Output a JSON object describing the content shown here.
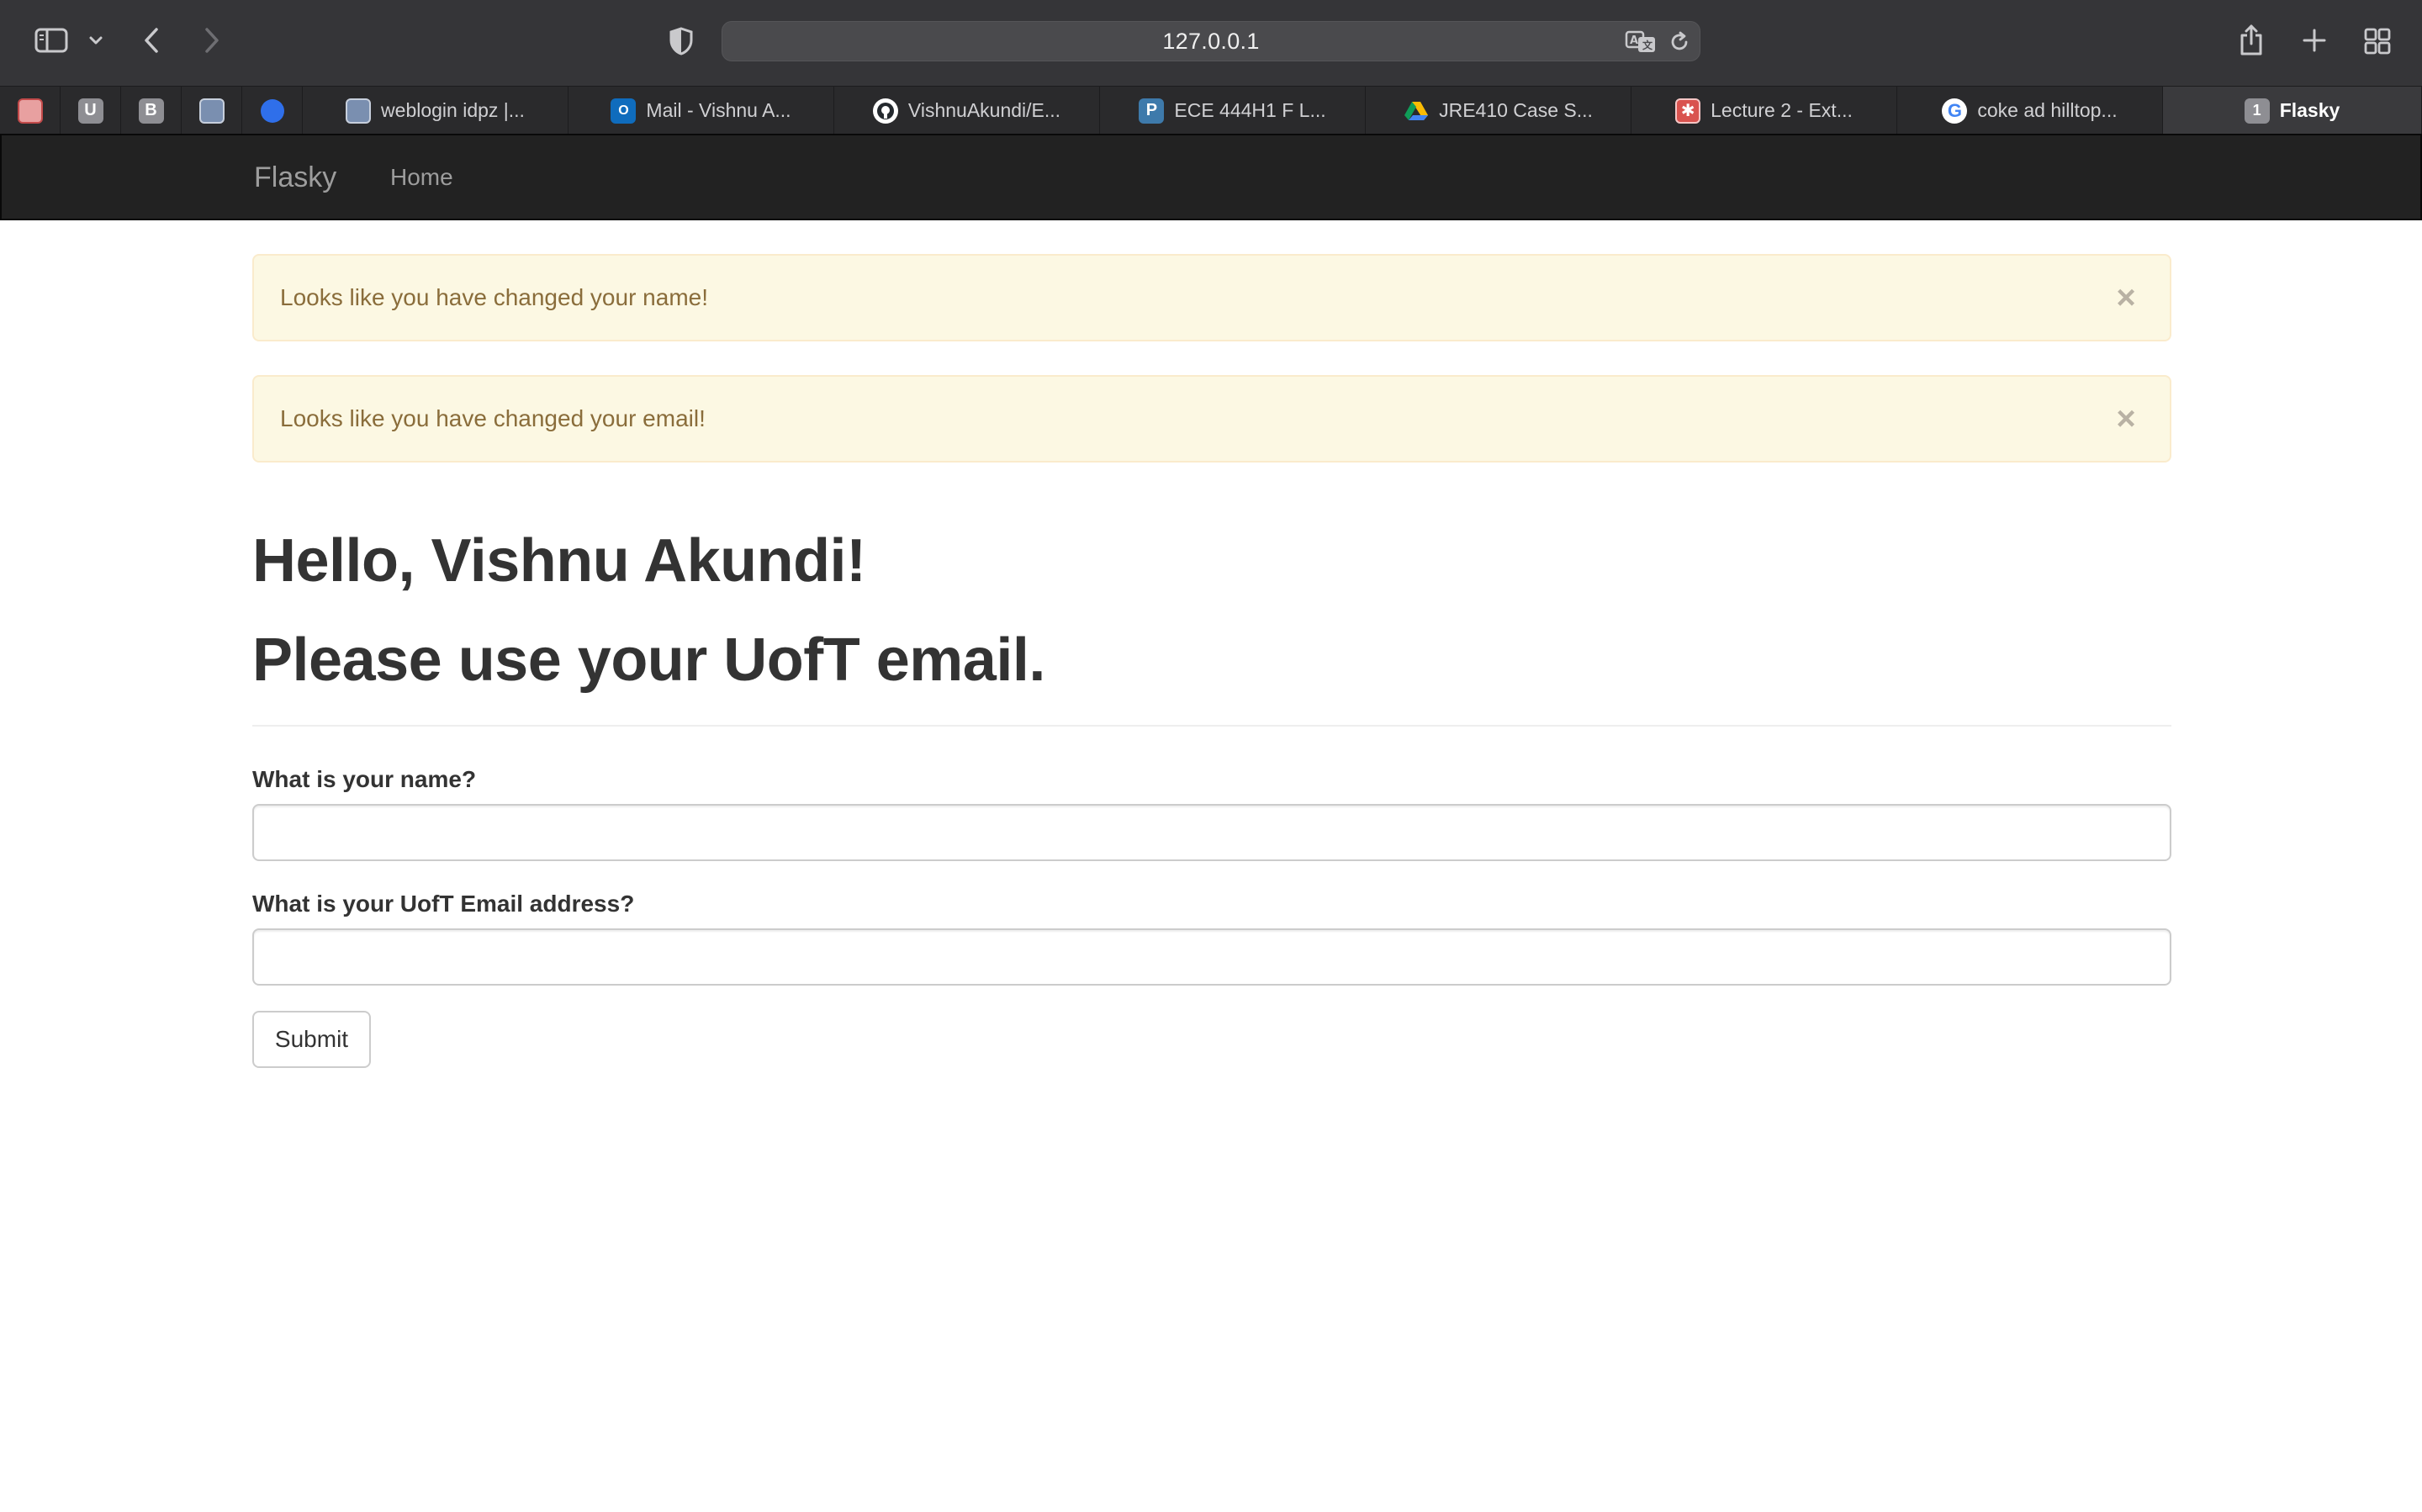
{
  "browser": {
    "url": "127.0.0.1",
    "tabs": [
      {
        "label": "weblogin idpz |...",
        "icon": "uoft-crest-icon"
      },
      {
        "label": "Mail - Vishnu A...",
        "icon": "outlook-icon"
      },
      {
        "label": "VishnuAkundi/E...",
        "icon": "github-icon"
      },
      {
        "label": "ECE 444H1 F L...",
        "icon": "piazza-icon"
      },
      {
        "label": "JRE410 Case S...",
        "icon": "google-drive-icon"
      },
      {
        "label": "Lecture 2 - Ext...",
        "icon": "lecture-icon"
      },
      {
        "label": "coke ad hilltop...",
        "icon": "google-icon"
      },
      {
        "label": "Flasky",
        "icon": "tab-badge-icon",
        "badge": "1",
        "active": true
      }
    ],
    "pinned_tabs": [
      {
        "icon": "pinned-red-grid-icon",
        "letter": ""
      },
      {
        "icon": "pinned-u-icon",
        "letter": "U"
      },
      {
        "icon": "pinned-b-icon",
        "letter": "B"
      },
      {
        "icon": "pinned-crest-icon",
        "letter": ""
      },
      {
        "icon": "pinned-blue-circle-icon",
        "letter": ""
      }
    ]
  },
  "navbar": {
    "brand": "Flasky",
    "home": "Home"
  },
  "alerts": [
    {
      "text": "Looks like you have changed your name!",
      "close": "×"
    },
    {
      "text": "Looks like you have changed your email!",
      "close": "×"
    }
  ],
  "page": {
    "greeting": "Hello, Vishnu Akundi!",
    "notice": "Please use your UofT email."
  },
  "form": {
    "name_label": "What is your name?",
    "name_value": "",
    "email_label": "What is your UofT Email address?",
    "email_value": "",
    "submit": "Submit"
  },
  "colors": {
    "chrome": "#353538",
    "navbar": "#222222",
    "alert_bg": "#fcf8e3",
    "alert_text": "#8a6d3b",
    "heading": "#333333"
  }
}
